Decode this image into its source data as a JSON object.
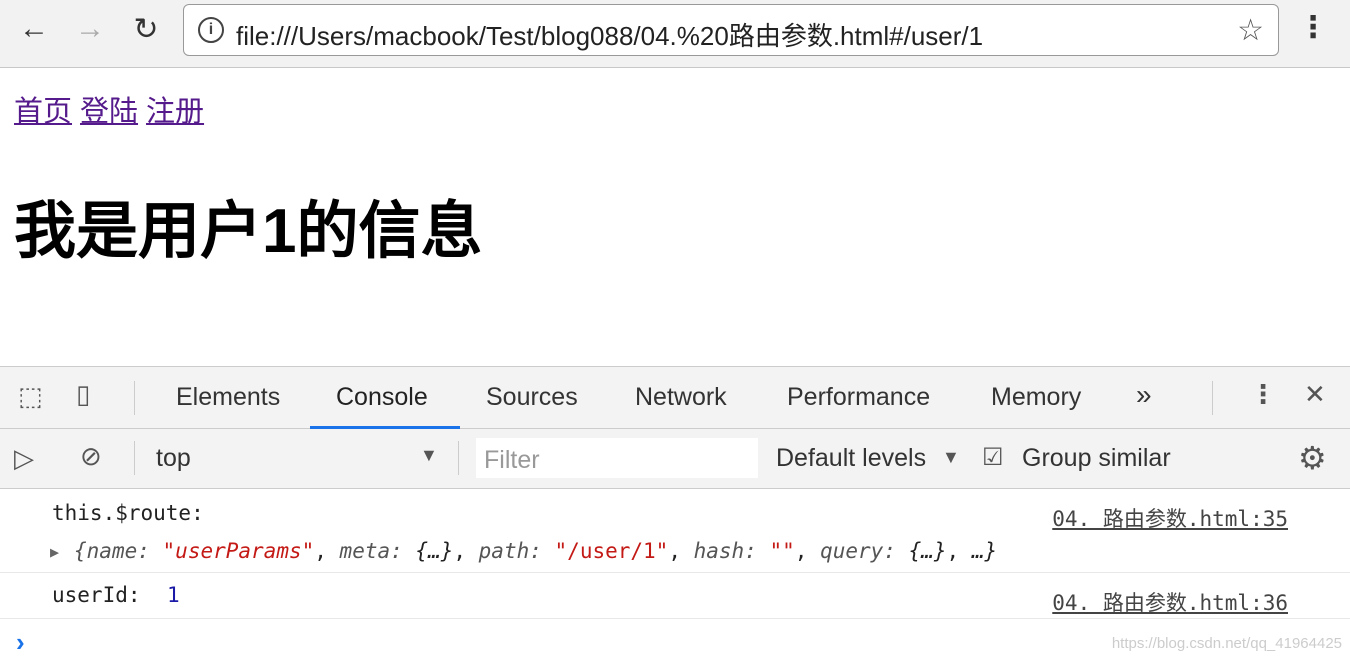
{
  "browser": {
    "url": "file:///Users/macbook/Test/blog088/04.%20路由参数.html#/user/1",
    "back_icon": "arrow-left-icon",
    "forward_icon": "arrow-right-icon",
    "reload_icon": "reload-icon"
  },
  "page": {
    "links": [
      "首页",
      "登陆",
      "注册"
    ],
    "heading": "我是用户1的信息"
  },
  "devtools": {
    "tabs": [
      "Elements",
      "Console",
      "Sources",
      "Network",
      "Performance",
      "Memory"
    ],
    "active_tab": "Console",
    "context": "top",
    "filter_placeholder": "Filter",
    "levels": "Default levels",
    "group_similar": "Group similar",
    "group_similar_checked": true,
    "console": [
      {
        "label": "this.$route:",
        "source": "04. 路由参数.html:35",
        "object": {
          "k1": "name",
          "v1": "\"userParams\"",
          "k2": "meta",
          "v2": "{…}",
          "k3": "path",
          "v3": "\"/user/1\"",
          "k4": "hash",
          "v4": "\"\"",
          "k5": "query",
          "v5": "{…}",
          "rest": "…"
        }
      },
      {
        "label": "userId:",
        "value": "1",
        "source": "04. 路由参数.html:36"
      }
    ]
  },
  "watermark": "https://blog.csdn.net/qq_41964425"
}
